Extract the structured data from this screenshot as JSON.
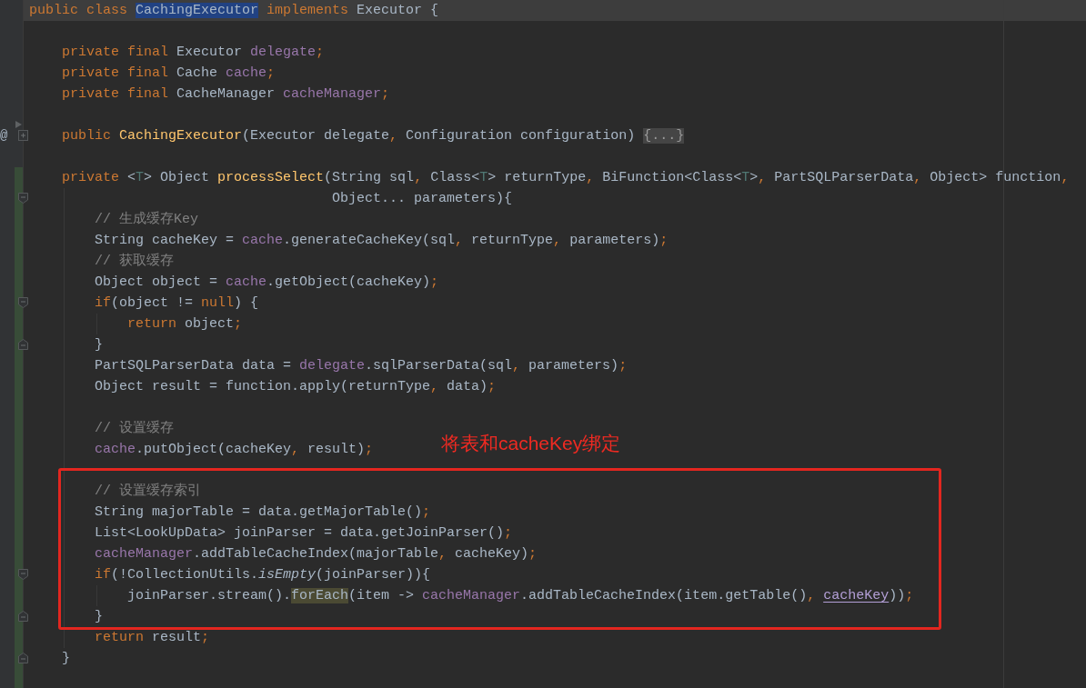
{
  "editor": {
    "lines": [
      {
        "tokens": [
          {
            "text": "public class ",
            "kind": "keyword"
          },
          {
            "text": "CachingExecutor",
            "kind": "selection"
          },
          {
            "text": " implements ",
            "kind": "keyword"
          },
          {
            "text": "Executor {",
            "kind": "plain"
          }
        ],
        "changed": false,
        "current": true,
        "children": [
          {
            "changed": false,
            "current": false
          },
          {
            "tokens": [
              {
                "text": "private final ",
                "kind": "keyword"
              },
              {
                "text": "Executor ",
                "kind": "plain"
              },
              {
                "text": "delegate",
                "kind": "field"
              },
              {
                "text": ";",
                "kind": "separator"
              }
            ],
            "changed": false,
            "current": false
          },
          {
            "tokens": [
              {
                "text": "private final ",
                "kind": "keyword"
              },
              {
                "text": "Cache ",
                "kind": "plain"
              },
              {
                "text": "cache",
                "kind": "field"
              },
              {
                "text": ";",
                "kind": "separator"
              }
            ],
            "changed": false,
            "current": false
          },
          {
            "tokens": [
              {
                "text": "private final ",
                "kind": "keyword"
              },
              {
                "text": "CacheManager ",
                "kind": "plain"
              },
              {
                "text": "cacheManager",
                "kind": "field"
              },
              {
                "text": ";",
                "kind": "separator"
              }
            ],
            "changed": false,
            "current": false
          },
          {
            "changed": false,
            "current": false
          },
          {
            "kind": "collapsed",
            "tokens": [
              {
                "text": "public ",
                "kind": "keyword"
              },
              {
                "text": "CachingExecutor",
                "kind": "method"
              },
              {
                "text": "(Executor delegate",
                "kind": "plain"
              },
              {
                "text": ", ",
                "kind": "separator"
              },
              {
                "text": "Configuration configuration) ",
                "kind": "plain"
              },
              {
                "text": "{...}",
                "kind": "folded"
              }
            ],
            "changed": false,
            "current": false,
            "gutter_mark": "@"
          },
          {
            "changed": false,
            "current": false
          },
          {
            "tokens": [
              {
                "text": "private ",
                "kind": "keyword"
              },
              {
                "text": "<",
                "kind": "plain"
              },
              {
                "text": "T",
                "kind": "typeparam"
              },
              {
                "text": "> Object ",
                "kind": "plain"
              },
              {
                "text": "processSelect",
                "kind": "method"
              },
              {
                "text": "(String sql",
                "kind": "plain"
              },
              {
                "text": ", ",
                "kind": "separator"
              },
              {
                "text": "Class<",
                "kind": "plain"
              },
              {
                "text": "T",
                "kind": "typeparam"
              },
              {
                "text": "> returnType",
                "kind": "plain"
              },
              {
                "text": ", ",
                "kind": "separator"
              },
              {
                "text": "BiFunction<Class<",
                "kind": "plain"
              },
              {
                "text": "T",
                "kind": "typeparam"
              },
              {
                "text": ">",
                "kind": "plain"
              },
              {
                "text": ", ",
                "kind": "separator"
              },
              {
                "text": "PartSQLParserData",
                "kind": "plain"
              },
              {
                "text": ", ",
                "kind": "separator"
              },
              {
                "text": "Object> function",
                "kind": "plain"
              },
              {
                "text": ",",
                "kind": "separator"
              }
            ],
            "changed": true,
            "current": false,
            "continuation": {
              "kind": "fold_start",
              "tokens": [
                {
                  "text": "Object... parameters){",
                  "kind": "plain"
                }
              ],
              "changed": true,
              "current": false
            },
            "children": [
              {
                "tokens": [
                  {
                    "text": "// 生成缓存Key",
                    "kind": "comment"
                  }
                ],
                "changed": true,
                "current": false
              },
              {
                "tokens": [
                  {
                    "text": "String cacheKey = ",
                    "kind": "plain"
                  },
                  {
                    "text": "cache",
                    "kind": "field"
                  },
                  {
                    "text": ".generateCacheKey(sql",
                    "kind": "plain"
                  },
                  {
                    "text": ", ",
                    "kind": "separator"
                  },
                  {
                    "text": "returnType",
                    "kind": "plain"
                  },
                  {
                    "text": ", ",
                    "kind": "separator"
                  },
                  {
                    "text": "parameters)",
                    "kind": "plain"
                  },
                  {
                    "text": ";",
                    "kind": "separator"
                  }
                ],
                "changed": true,
                "current": false
              },
              {
                "tokens": [
                  {
                    "text": "// 获取缓存",
                    "kind": "comment"
                  }
                ],
                "changed": true,
                "current": false
              },
              {
                "tokens": [
                  {
                    "text": "Object object = ",
                    "kind": "plain"
                  },
                  {
                    "text": "cache",
                    "kind": "field"
                  },
                  {
                    "text": ".getObject(cacheKey)",
                    "kind": "plain"
                  },
                  {
                    "text": ";",
                    "kind": "separator"
                  }
                ],
                "changed": true,
                "current": false
              },
              {
                "kind": "fold_start",
                "tokens": [
                  {
                    "text": "if",
                    "kind": "keyword"
                  },
                  {
                    "text": "(object != ",
                    "kind": "plain"
                  },
                  {
                    "text": "null",
                    "kind": "keyword"
                  },
                  {
                    "text": ") {",
                    "kind": "plain"
                  }
                ],
                "changed": true,
                "current": false,
                "children": [
                  {
                    "tokens": [
                      {
                        "text": "return ",
                        "kind": "keyword"
                      },
                      {
                        "text": "object",
                        "kind": "plain"
                      },
                      {
                        "text": ";",
                        "kind": "separator"
                      }
                    ],
                    "changed": true,
                    "current": false
                  }
                ]
              },
              {
                "kind": "fold_end",
                "tokens": [
                  {
                    "text": "}",
                    "kind": "plain"
                  }
                ],
                "changed": true,
                "current": false
              },
              {
                "tokens": [
                  {
                    "text": "PartSQLParserData data = ",
                    "kind": "plain"
                  },
                  {
                    "text": "delegate",
                    "kind": "field"
                  },
                  {
                    "text": ".sqlParserData(sql",
                    "kind": "plain"
                  },
                  {
                    "text": ", ",
                    "kind": "separator"
                  },
                  {
                    "text": "parameters)",
                    "kind": "plain"
                  },
                  {
                    "text": ";",
                    "kind": "separator"
                  }
                ],
                "changed": true,
                "current": false
              },
              {
                "tokens": [
                  {
                    "text": "Object result = function.apply(returnType",
                    "kind": "plain"
                  },
                  {
                    "text": ", ",
                    "kind": "separator"
                  },
                  {
                    "text": "data)",
                    "kind": "plain"
                  },
                  {
                    "text": ";",
                    "kind": "separator"
                  }
                ],
                "changed": true,
                "current": false
              },
              {
                "changed": true,
                "current": false
              },
              {
                "tokens": [
                  {
                    "text": "// 设置缓存",
                    "kind": "comment"
                  }
                ],
                "changed": true,
                "current": false
              },
              {
                "tokens": [
                  {
                    "text": "cache",
                    "kind": "field"
                  },
                  {
                    "text": ".putObject(cacheKey",
                    "kind": "plain"
                  },
                  {
                    "text": ", ",
                    "kind": "separator"
                  },
                  {
                    "text": "result)",
                    "kind": "plain"
                  },
                  {
                    "text": ";",
                    "kind": "separator"
                  }
                ],
                "changed": true,
                "current": false
              },
              {
                "changed": true,
                "current": false
              },
              {
                "tokens": [
                  {
                    "text": "// 设置缓存索引",
                    "kind": "comment"
                  }
                ],
                "changed": true,
                "current": false
              },
              {
                "tokens": [
                  {
                    "text": "String majorTable = data.getMajorTable()",
                    "kind": "plain"
                  },
                  {
                    "text": ";",
                    "kind": "separator"
                  }
                ],
                "changed": true,
                "current": false
              },
              {
                "tokens": [
                  {
                    "text": "List<LookUpData> joinParser = data.getJoinParser()",
                    "kind": "plain"
                  },
                  {
                    "text": ";",
                    "kind": "separator"
                  }
                ],
                "changed": true,
                "current": false
              },
              {
                "tokens": [
                  {
                    "text": "cacheManager",
                    "kind": "field"
                  },
                  {
                    "text": ".addTableCacheIndex(majorTable",
                    "kind": "plain"
                  },
                  {
                    "text": ", ",
                    "kind": "separator"
                  },
                  {
                    "text": "cacheKey)",
                    "kind": "plain"
                  },
                  {
                    "text": ";",
                    "kind": "separator"
                  }
                ],
                "changed": true,
                "current": false
              },
              {
                "kind": "fold_start",
                "tokens": [
                  {
                    "text": "if",
                    "kind": "keyword"
                  },
                  {
                    "text": "(!CollectionUtils.",
                    "kind": "plain"
                  },
                  {
                    "text": "isEmpty",
                    "kind": "static_call"
                  },
                  {
                    "text": "(joinParser)){",
                    "kind": "plain"
                  }
                ],
                "changed": true,
                "current": false,
                "children": [
                  {
                    "tokens": [
                      {
                        "text": "joinParser.stream().",
                        "kind": "plain"
                      },
                      {
                        "text": "forEach",
                        "kind": "usage"
                      },
                      {
                        "text": "(item -> ",
                        "kind": "plain"
                      },
                      {
                        "text": "cacheManager",
                        "kind": "field"
                      },
                      {
                        "text": ".addTableCacheIndex(item.getTable()",
                        "kind": "plain"
                      },
                      {
                        "text": ", ",
                        "kind": "separator"
                      },
                      {
                        "text": "cacheKey",
                        "kind": "captured"
                      },
                      {
                        "text": "))",
                        "kind": "plain"
                      },
                      {
                        "text": ";",
                        "kind": "separator"
                      }
                    ],
                    "changed": true,
                    "current": false
                  }
                ]
              },
              {
                "kind": "fold_end",
                "tokens": [
                  {
                    "text": "}",
                    "kind": "plain"
                  }
                ],
                "changed": true,
                "current": false
              },
              {
                "tokens": [
                  {
                    "text": "return ",
                    "kind": "keyword"
                  },
                  {
                    "text": "result",
                    "kind": "plain"
                  },
                  {
                    "text": ";",
                    "kind": "separator"
                  }
                ],
                "changed": true,
                "current": false
              }
            ]
          },
          {
            "kind": "fold_end",
            "tokens": [
              {
                "text": "}",
                "kind": "plain"
              }
            ],
            "changed": true,
            "current": false
          },
          {
            "changed": true,
            "current": false
          }
        ]
      }
    ]
  },
  "annotation": {
    "label": "将表和cacheKey绑定"
  }
}
